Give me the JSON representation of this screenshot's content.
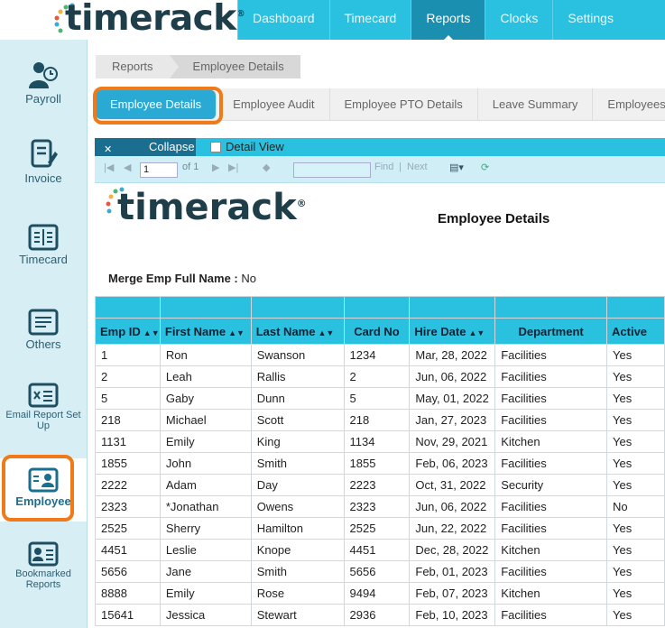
{
  "brand": {
    "name": "timerack",
    "reg": "®"
  },
  "nav": {
    "items": [
      "Dashboard",
      "Timecard",
      "Reports",
      "Clocks",
      "Settings"
    ],
    "active": "Reports"
  },
  "sidebar": {
    "items": [
      {
        "label": "Payroll",
        "icon": "payroll-icon"
      },
      {
        "label": "Invoice",
        "icon": "invoice-icon"
      },
      {
        "label": "Timecard",
        "icon": "timecard-icon"
      },
      {
        "label": "Others",
        "icon": "others-icon"
      },
      {
        "label": "Email Report Set Up",
        "icon": "email-report-icon"
      },
      {
        "label": "Employee",
        "icon": "employee-icon"
      },
      {
        "label": "Bookmarked Reports",
        "icon": "bookmark-icon"
      }
    ],
    "active": "Employee"
  },
  "breadcrumb": [
    "Reports",
    "Employee Details"
  ],
  "tabs": [
    "Employee Details",
    "Employee Audit",
    "Employee PTO Details",
    "Leave Summary",
    "Employees"
  ],
  "active_tab": "Employee Details",
  "toolbar": {
    "collapse": "Collapse",
    "detail_view": "Detail View",
    "page_value": "1",
    "of_text": "of 1",
    "find": "Find",
    "next": "Next"
  },
  "report": {
    "logo": "timerack",
    "title": "Employee Details",
    "merge_label": "Merge Emp Full Name :",
    "merge_value": "No",
    "columns": [
      "Emp ID",
      "First Name",
      "Last Name",
      "Card No",
      "Hire Date",
      "Department",
      "Active"
    ],
    "rows": [
      [
        "1",
        "Ron",
        "Swanson",
        "1234",
        "Mar, 28, 2022",
        "Facilities",
        "Yes"
      ],
      [
        "2",
        "Leah",
        "Rallis",
        "2",
        "Jun, 06, 2022",
        "Facilities",
        "Yes"
      ],
      [
        "5",
        "Gaby",
        "Dunn",
        "5",
        "May, 01, 2022",
        "Facilities",
        "Yes"
      ],
      [
        "218",
        "Michael",
        "Scott",
        "218",
        "Jan, 27, 2023",
        "Facilities",
        "Yes"
      ],
      [
        "1131",
        "Emily",
        "King",
        "1134",
        "Nov, 29, 2021",
        "Kitchen",
        "Yes"
      ],
      [
        "1855",
        "John",
        "Smith",
        "1855",
        "Feb, 06, 2023",
        "Facilities",
        "Yes"
      ],
      [
        "2222",
        "Adam",
        "Day",
        "2223",
        "Oct, 31, 2022",
        "Security",
        "Yes"
      ],
      [
        "2323",
        "*Jonathan",
        "Owens",
        "2323",
        "Jun, 06, 2022",
        "Facilities",
        "No"
      ],
      [
        "2525",
        "Sherry",
        "Hamilton",
        "2525",
        "Jun, 22, 2022",
        "Facilities",
        "Yes"
      ],
      [
        "4451",
        "Leslie",
        "Knope",
        "4451",
        "Dec, 28, 2022",
        "Kitchen",
        "Yes"
      ],
      [
        "5656",
        "Jane",
        "Smith",
        "5656",
        "Feb, 01, 2023",
        "Facilities",
        "Yes"
      ],
      [
        "8888",
        "Emily",
        "Rose",
        "9494",
        "Feb, 07, 2023",
        "Kitchen",
        "Yes"
      ],
      [
        "15641",
        "Jessica",
        "Stewart",
        "2936",
        "Feb, 10, 2023",
        "Facilities",
        "Yes"
      ]
    ]
  },
  "colors": {
    "accent": "#29c1df",
    "active_nav": "#1a8fb0",
    "highlight": "#f07a1a"
  }
}
